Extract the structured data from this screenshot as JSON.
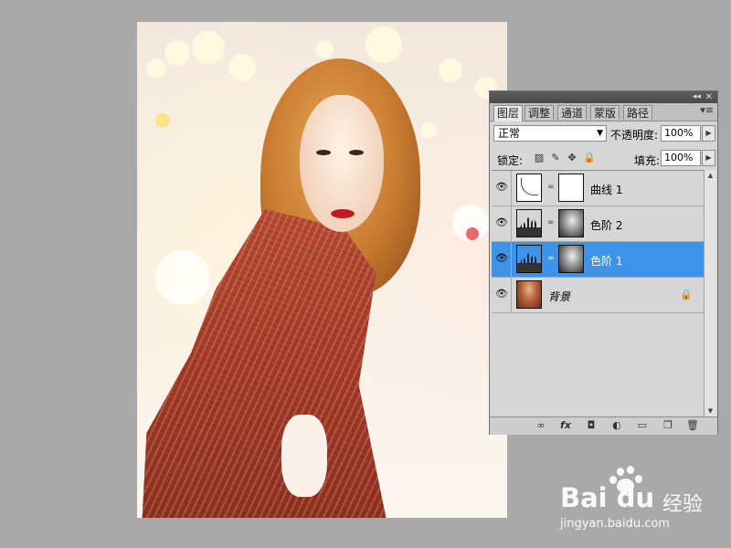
{
  "canvas": {
    "image": "portrait-photo"
  },
  "panel": {
    "collapse_glyph": "◂◂",
    "close_glyph": "✕",
    "menu_glyph": "▾≡",
    "tabs": [
      {
        "label": "图层",
        "active": true
      },
      {
        "label": "调整",
        "active": false
      },
      {
        "label": "通道",
        "active": false
      },
      {
        "label": "蒙版",
        "active": false
      },
      {
        "label": "路径",
        "active": false
      }
    ],
    "blend_mode": "正常",
    "opacity_label": "不透明度:",
    "opacity_value": "100%",
    "lock_label": "锁定:",
    "fill_label": "填充:",
    "fill_value": "100%",
    "layers": [
      {
        "name": "曲线 1",
        "type": "curves",
        "visible": true,
        "selected": false
      },
      {
        "name": "色阶 2",
        "type": "levels",
        "visible": true,
        "selected": false
      },
      {
        "name": "色阶 1",
        "type": "levels",
        "visible": true,
        "selected": true
      },
      {
        "name": "背景",
        "type": "background",
        "visible": true,
        "selected": false,
        "locked": true
      }
    ],
    "footer_icons": [
      "link-icon",
      "fx-icon",
      "mask-icon",
      "adjustment-icon",
      "folder-icon",
      "new-layer-icon",
      "trash-icon"
    ],
    "footer_labels": {
      "link": "∞",
      "fx": "fx",
      "mask": "◘",
      "adjust": "◐",
      "folder": "▭",
      "new": "❐",
      "trash": "🗑"
    }
  },
  "watermark": {
    "brand": "Bai du",
    "cn": "经验",
    "url": "jingyan.baidu.com"
  },
  "colors": {
    "selection": "#3d93e8",
    "panel_bg": "#d6d6d6",
    "workspace_bg": "#a9a9a9"
  }
}
